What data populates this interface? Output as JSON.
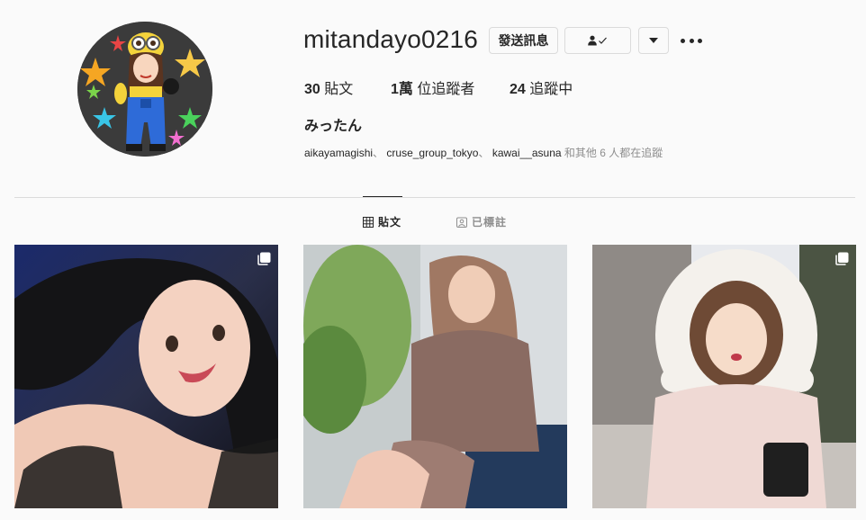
{
  "profile": {
    "username": "mitandayo0216",
    "full_name": "みったん",
    "message_button": "發送訊息",
    "stats": {
      "posts_count": "30",
      "posts_label": " 貼文",
      "followers_count": "1萬",
      "followers_label": " 位追蹤者",
      "following_count": "24",
      "following_label": " 追蹤中"
    },
    "followed_by": {
      "accounts": [
        "aikayamagishi",
        "cruse_group_tokyo",
        "kawai__asuna"
      ],
      "separator": "、",
      "suffix": " 和其他 6 人都在追蹤"
    }
  },
  "tabs": [
    {
      "label": "貼文",
      "icon": "grid-icon",
      "active": true
    },
    {
      "label": "已標註",
      "icon": "tagged-icon",
      "active": false
    }
  ],
  "posts": [
    {
      "type": "carousel",
      "icon": "multiple-photos-icon"
    },
    {
      "type": "photo"
    },
    {
      "type": "carousel",
      "icon": "multiple-photos-icon"
    }
  ]
}
